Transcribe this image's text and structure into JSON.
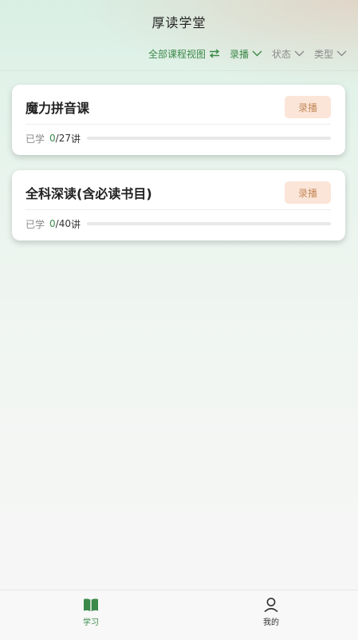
{
  "header": {
    "title": "厚读学堂"
  },
  "filters": {
    "view_label": "全部课程视图",
    "type_filter": "录播",
    "status_filter": "状态",
    "category_filter": "类型"
  },
  "courses": [
    {
      "title": "魔力拼音课",
      "tag": "录播",
      "learned_label": "已学",
      "learned": "0",
      "total": "/27",
      "unit": "讲",
      "progress": 0
    },
    {
      "title": "全科深读(含必读书目)",
      "tag": "录播",
      "learned_label": "已学",
      "learned": "0",
      "total": "/40",
      "unit": "讲",
      "progress": 0
    }
  ],
  "tabbar": {
    "learn_label": "学习",
    "mine_label": "我的"
  },
  "colors": {
    "accent": "#3c8a4a",
    "tag_bg": "#fbe5d8",
    "tag_text": "#c58a5b"
  },
  "icons": {
    "swap": "swap-arrows-icon",
    "chevron": "chevron-down-icon",
    "learn": "book-icon",
    "mine": "user-icon"
  }
}
